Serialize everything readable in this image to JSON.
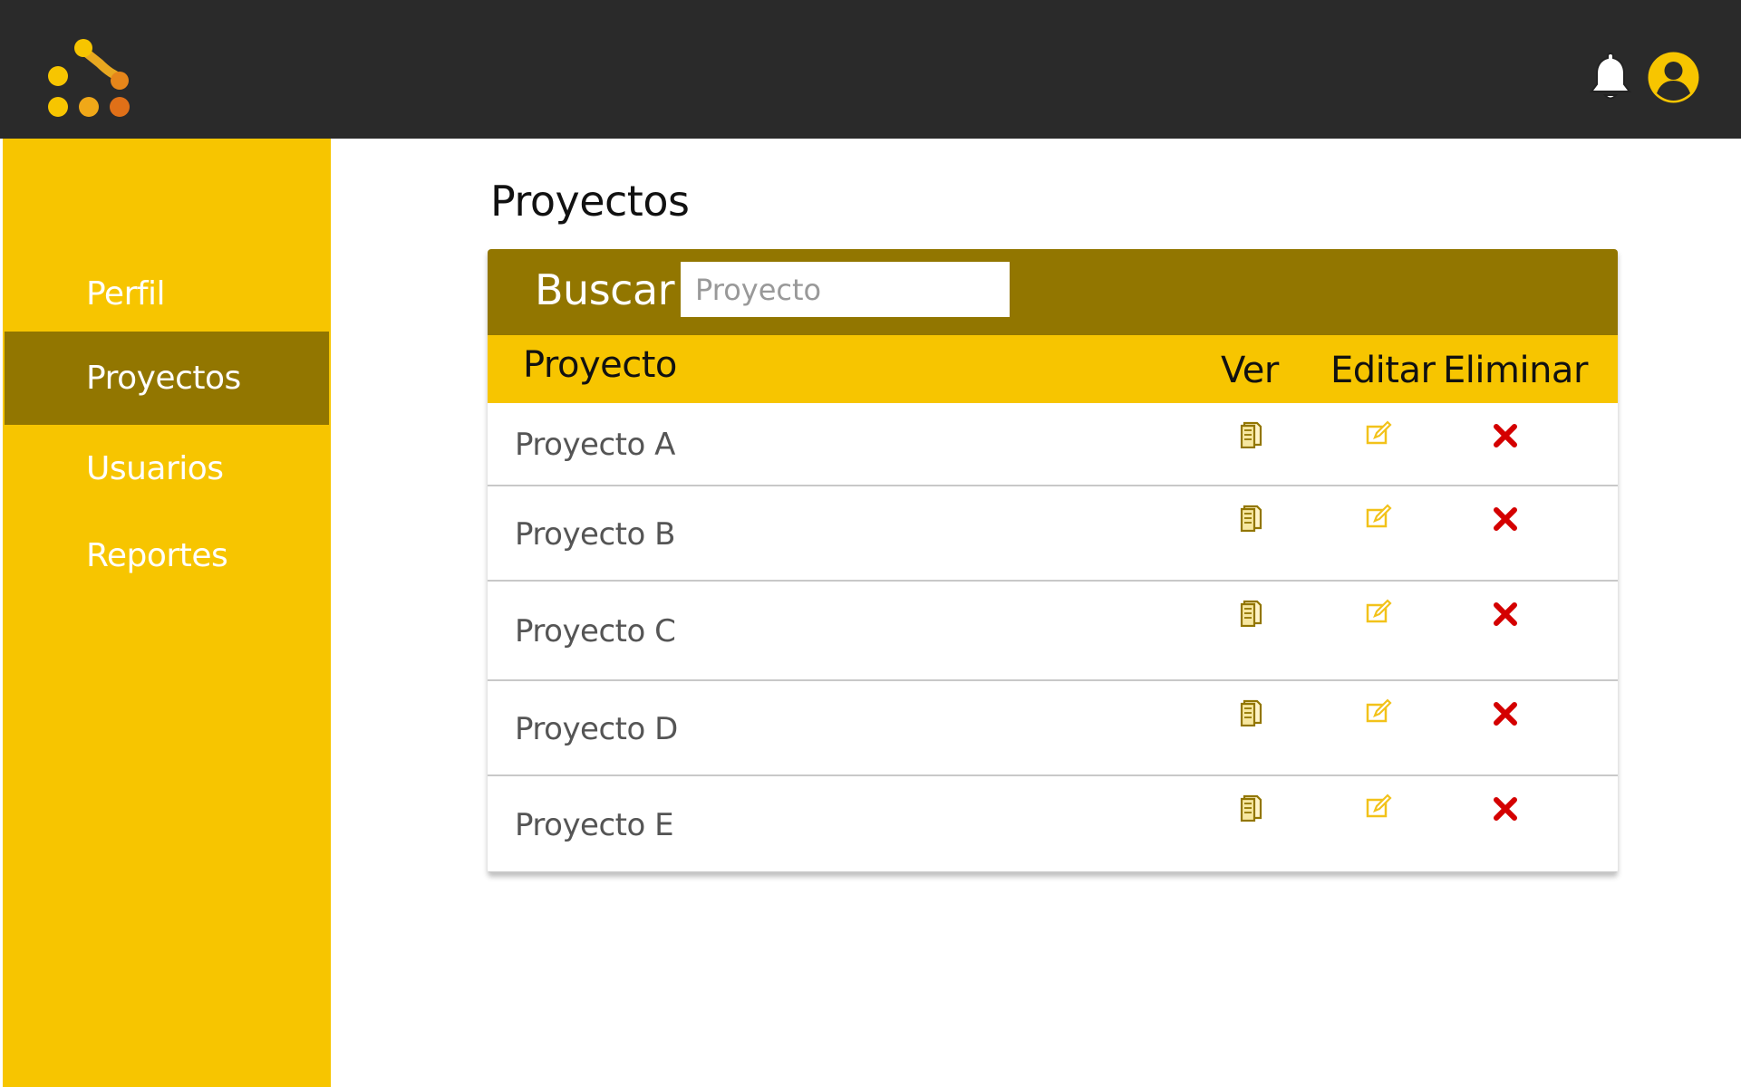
{
  "header": {
    "logo_icon": "app-logo",
    "notification_icon": "bell-icon",
    "user_icon": "user-circle-icon",
    "colors": {
      "bar": "#2a2a2a",
      "accent": "#f7c500",
      "accent_dark": "#927600"
    }
  },
  "sidebar": {
    "items": [
      {
        "label": "Perfil",
        "active": false
      },
      {
        "label": "Proyectos",
        "active": true
      },
      {
        "label": "Usuarios",
        "active": false
      },
      {
        "label": "Reportes",
        "active": false
      }
    ]
  },
  "main": {
    "title": "Proyectos",
    "search": {
      "label": "Buscar",
      "placeholder": "Proyecto",
      "value": ""
    },
    "table": {
      "columns": {
        "name": "Proyecto",
        "view": "Ver",
        "edit": "Editar",
        "delete": "Eliminar"
      },
      "action_icons": {
        "view": "document-icon",
        "edit": "edit-icon",
        "delete": "delete-x-icon"
      },
      "rows": [
        {
          "name": "Proyecto A"
        },
        {
          "name": "Proyecto B"
        },
        {
          "name": "Proyecto C"
        },
        {
          "name": "Proyecto D"
        },
        {
          "name": "Proyecto E"
        }
      ]
    }
  }
}
